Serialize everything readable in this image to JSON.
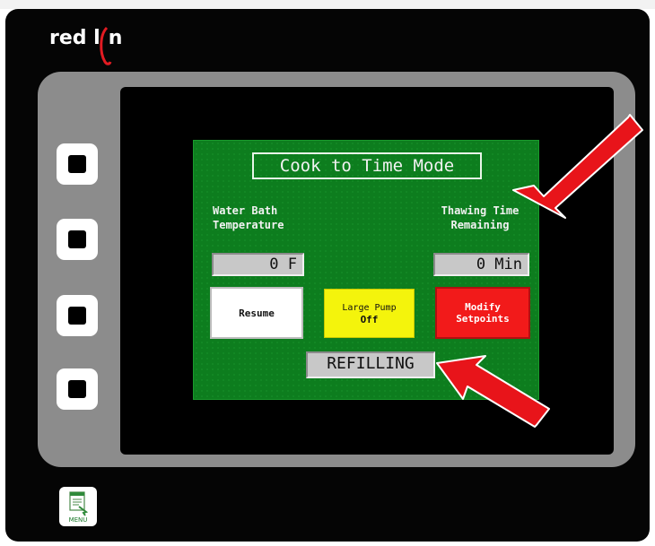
{
  "brand": {
    "logo_text_left": "red l",
    "logo_text_right": "n"
  },
  "screen": {
    "title": "Cook to Time Mode",
    "water_bath_label_line1": "Water Bath",
    "water_bath_label_line2": "Temperature",
    "thawing_label_line1": "Thawing Time",
    "thawing_label_line2": "Remaining",
    "temperature_value": "0 F",
    "time_remaining_value": "0 Min",
    "status_text": "REFILLING"
  },
  "buttons": {
    "resume_label": "Resume",
    "pump_label_line1": "Large Pump",
    "pump_label_line2": "Off",
    "modify_label_line1": "Modify",
    "modify_label_line2": "Setpoints"
  },
  "hardware": {
    "menu_key_label": "MENU"
  },
  "colors": {
    "hmi_background": "#0d7d1e",
    "resume_button": "#ffffff",
    "pump_button": "#f4f40c",
    "modify_button": "#f21a1a",
    "annotation_arrow": "#e8141a"
  },
  "icons": {
    "side_keys": "square-key-icon",
    "menu_key": "menu-document-icon",
    "annotation": "red-arrow-icon"
  }
}
